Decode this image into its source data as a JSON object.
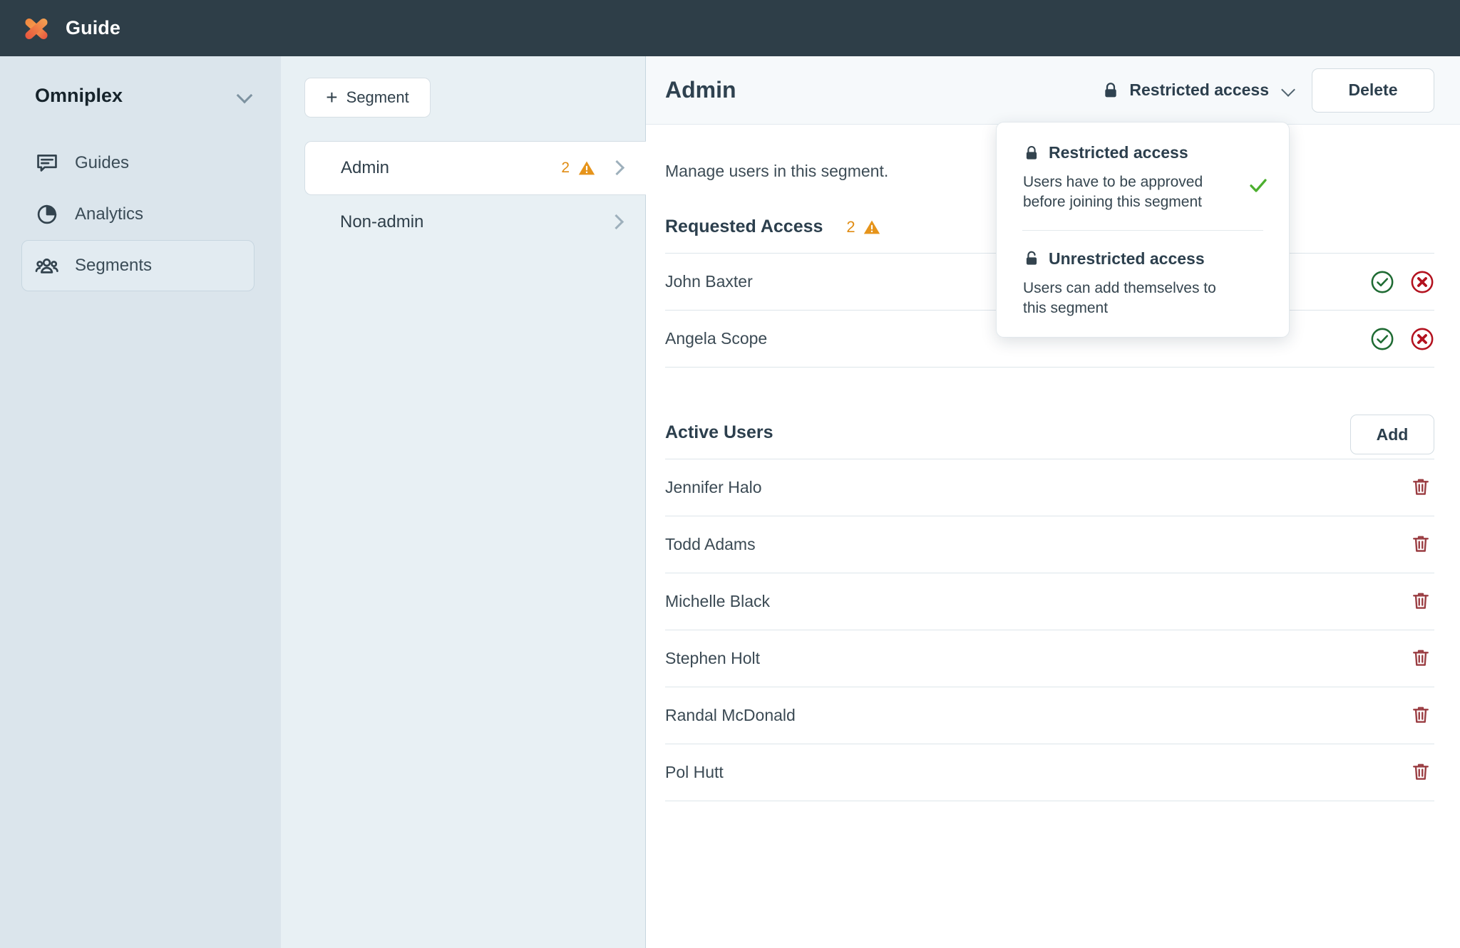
{
  "topbar": {
    "brand": "Guide",
    "logo_icon": "x-logo-icon"
  },
  "sidebar": {
    "workspace": "Omniplex",
    "workspace_chevron_icon": "chevron-down-icon",
    "items": [
      {
        "label": "Guides",
        "icon": "message-square-icon",
        "active": false
      },
      {
        "label": "Analytics",
        "icon": "pie-chart-icon",
        "active": false
      },
      {
        "label": "Segments",
        "icon": "users-group-icon",
        "active": true
      }
    ]
  },
  "segment_panel": {
    "new_button_label": "Segment",
    "new_button_icon": "plus-icon",
    "rows": [
      {
        "label": "Admin",
        "count": "2",
        "warning_icon": "warning-triangle-icon",
        "chevron_icon": "chevron-right-icon",
        "selected": true
      },
      {
        "label": "Non-admin",
        "count": "",
        "warning_icon": "",
        "chevron_icon": "chevron-right-icon",
        "selected": false
      }
    ]
  },
  "main": {
    "title": "Admin",
    "access": {
      "label": "Restricted access",
      "lock_icon": "lock-closed-icon",
      "chevron_icon": "chevron-down-icon"
    },
    "delete_label": "Delete",
    "subtitle": "Manage users in this segment.",
    "requested": {
      "title": "Requested Access",
      "count": "2",
      "warning_icon": "warning-triangle-icon",
      "users": [
        {
          "name": "John Baxter",
          "approve_icon": "check-circle-icon",
          "reject_icon": "x-circle-icon"
        },
        {
          "name": "Angela Scope",
          "approve_icon": "check-circle-icon",
          "reject_icon": "x-circle-icon"
        }
      ]
    },
    "active": {
      "title": "Active Users",
      "add_label": "Add",
      "users": [
        {
          "name": "Jennifer Halo",
          "delete_icon": "trash-icon"
        },
        {
          "name": "Todd Adams",
          "delete_icon": "trash-icon"
        },
        {
          "name": "Michelle Black",
          "delete_icon": "trash-icon"
        },
        {
          "name": "Stephen Holt",
          "delete_icon": "trash-icon"
        },
        {
          "name": "Randal McDonald",
          "delete_icon": "trash-icon"
        },
        {
          "name": "Pol Hutt",
          "delete_icon": "trash-icon"
        }
      ]
    }
  },
  "dropdown": {
    "options": [
      {
        "title": "Restricted access",
        "description": "Users have to be approved before joining this segment",
        "lock_icon": "lock-closed-icon",
        "selected": true,
        "check_icon": "check-icon"
      },
      {
        "title": "Unrestricted access",
        "description": "Users can add themselves to this segment",
        "lock_icon": "lock-open-icon",
        "selected": false,
        "check_icon": ""
      }
    ]
  },
  "colors": {
    "topbar": "#2e3e48",
    "sidebar": "#dbe5ec",
    "seglist": "#e8f0f4",
    "warning": "#e08c13",
    "approve": "#1f6b33",
    "reject": "#b3121f",
    "trash": "#9a3d42",
    "check": "#4caf2f",
    "logo": "#ef7a45"
  }
}
